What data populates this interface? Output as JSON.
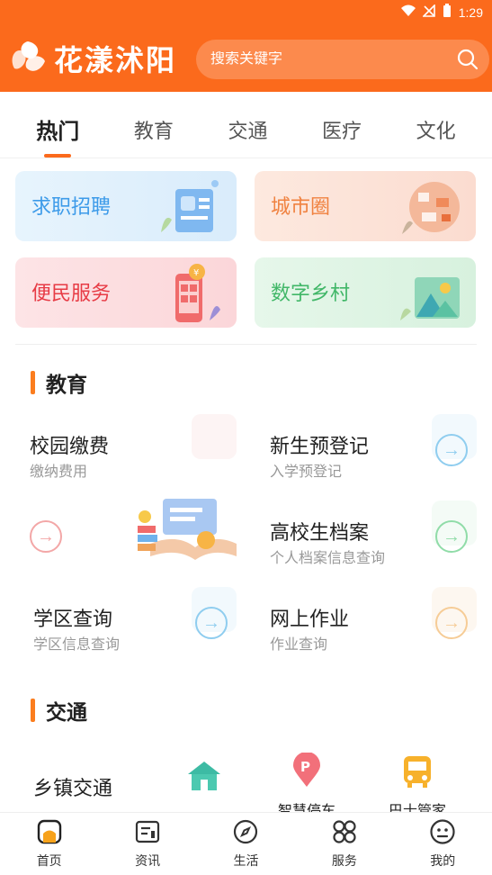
{
  "status_bar": {
    "time": "1:29"
  },
  "header": {
    "app_title": "花漾沭阳",
    "search_placeholder": "搜索关键字"
  },
  "tabs": [
    {
      "label": "热门",
      "active": true
    },
    {
      "label": "教育",
      "active": false
    },
    {
      "label": "交通",
      "active": false
    },
    {
      "label": "医疗",
      "active": false
    },
    {
      "label": "文化",
      "active": false
    }
  ],
  "quick_cards": [
    {
      "label": "求职招聘"
    },
    {
      "label": "城市圈"
    },
    {
      "label": "便民服务"
    },
    {
      "label": "数字乡村"
    }
  ],
  "education": {
    "title": "教育",
    "items": [
      {
        "title": "校园缴费",
        "sub": "缴纳费用"
      },
      {
        "title": "新生预登记",
        "sub": "入学预登记"
      },
      {
        "title": "高校生档案",
        "sub": "个人档案信息查询"
      },
      {
        "title": "学区查询",
        "sub": "学区信息查询"
      },
      {
        "title": "网上作业",
        "sub": "作业查询"
      }
    ]
  },
  "traffic": {
    "title": "交通",
    "items": [
      {
        "label": "乡镇交通"
      },
      {
        "label": "智慧停车"
      },
      {
        "label": "巴士管家"
      }
    ]
  },
  "bottom_nav": [
    {
      "label": "首页",
      "icon": "home-icon",
      "active": true
    },
    {
      "label": "资讯",
      "icon": "news-icon",
      "active": false
    },
    {
      "label": "生活",
      "icon": "compass-icon",
      "active": false
    },
    {
      "label": "服务",
      "icon": "grid-icon",
      "active": false
    },
    {
      "label": "我的",
      "icon": "profile-icon",
      "active": false
    }
  ],
  "colors": {
    "primary": "#fb6a1c",
    "accent_bar": "#fb7d1e"
  }
}
